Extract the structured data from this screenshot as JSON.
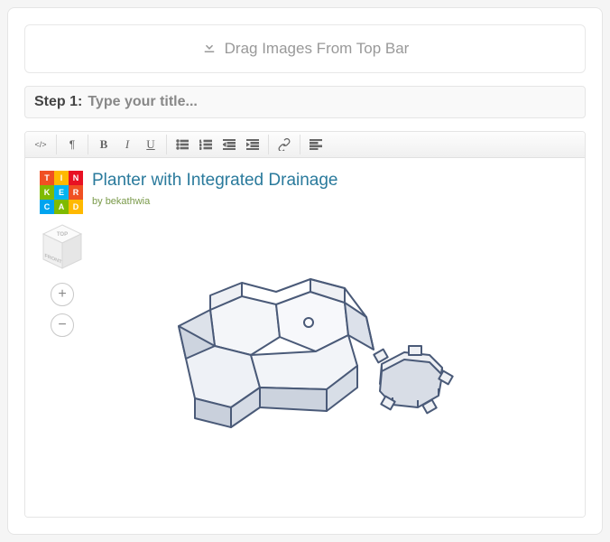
{
  "dropzone": {
    "label": "Drag Images From Top Bar"
  },
  "step": {
    "prefix": "Step 1:",
    "placeholder": "Type your title..."
  },
  "toolbar": {
    "sourceTip": "Source",
    "paragraphTip": "Paragraph",
    "boldTip": "Bold",
    "italicTip": "Italic",
    "underlineTip": "Underline",
    "ulTip": "Bulleted list",
    "olTip": "Numbered list",
    "outdentTip": "Decrease indent",
    "indentTip": "Increase indent",
    "linkTip": "Insert link",
    "alignTip": "Align"
  },
  "embed": {
    "logoText": [
      "T",
      "I",
      "N",
      "K",
      "E",
      "R",
      "C",
      "A",
      "D"
    ],
    "title": "Planter with Integrated Drainage",
    "byPrefix": "by ",
    "author": "bekathwia",
    "cube": {
      "top": "TOP",
      "front": "FRONT"
    },
    "zoomIn": "+",
    "zoomOut": "−"
  }
}
